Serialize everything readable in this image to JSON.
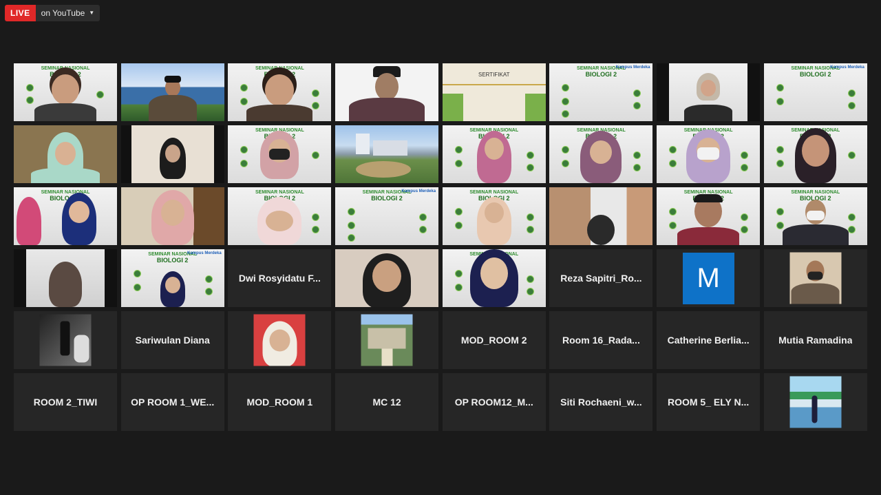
{
  "live": {
    "badge": "LIVE",
    "destination": "on YouTube"
  },
  "slides": {
    "title_small": "SEMINAR NASIONAL",
    "title_big": "BIOLOGI 2",
    "logo": "Kampus Merdeka"
  },
  "certificate": {
    "title": "SERTIFIKAT"
  },
  "participants": {
    "dwi": "Dwi Rosyidatu F...",
    "reza": "Reza Sapitri_Ro...",
    "m_initial": "M",
    "sariwulan": "Sariwulan Diana",
    "mod2": "MOD_ROOM 2",
    "room16": "Room 16_Rada...",
    "catherine": "Catherine Berlia...",
    "mutia": "Mutia Ramadina",
    "room2": "ROOM 2_TIWI",
    "op1": "OP ROOM 1_WE...",
    "mod1": "MOD_ROOM 1",
    "mc12": "MC 12",
    "op12": "OP ROOM12_M...",
    "siti": "Siti Rochaeni_w...",
    "room5": "ROOM 5_ ELY N..."
  },
  "colors": {
    "live": "#e02828",
    "active_speaker": "#e9e84a",
    "avatar_m": "#0e72c8"
  }
}
